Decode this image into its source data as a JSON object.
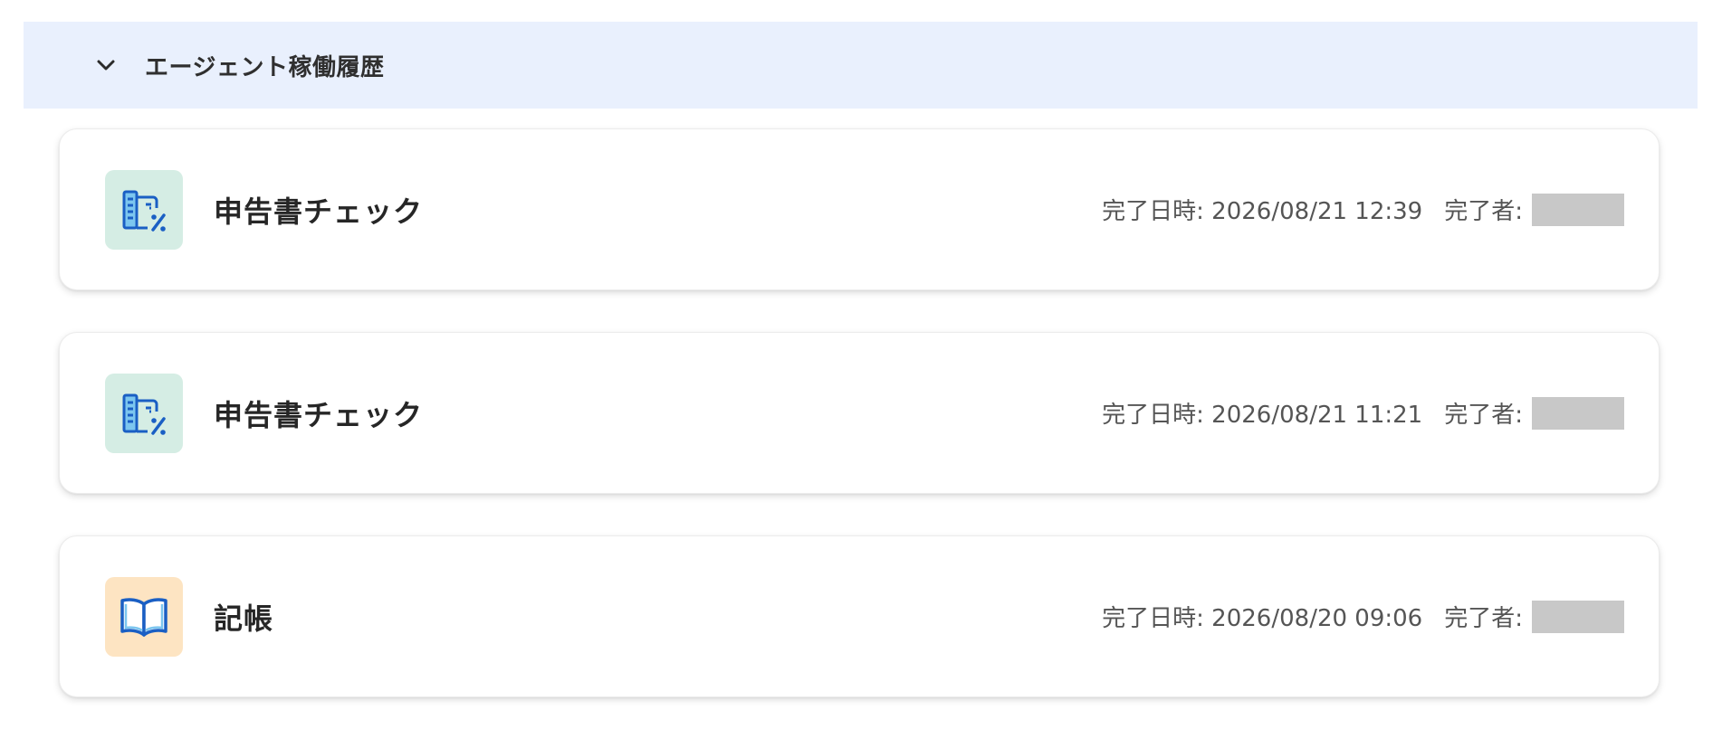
{
  "section": {
    "title": "エージェント稼働履歴",
    "expanded_icon": "chevron-down-icon"
  },
  "colors": {
    "header_bg": "#e9f0fd",
    "icon_teal_bg": "#d5ede4",
    "icon_peach_bg": "#fde4c2",
    "icon_blue": "#1a5fc4",
    "redacted": "#c8c8c8"
  },
  "history": [
    {
      "icon": "tax-document-check-icon",
      "title": "申告書チェック",
      "completed_at": "完了日時: 2026/08/21 12:39",
      "completed_by_label": "完了者:"
    },
    {
      "icon": "tax-document-check-icon",
      "title": "申告書チェック",
      "completed_at": "完了日時: 2026/08/21 11:21",
      "completed_by_label": "完了者:"
    },
    {
      "icon": "open-book-icon",
      "title": "記帳",
      "completed_at": "完了日時: 2026/08/20 09:06",
      "completed_by_label": "完了者:"
    }
  ]
}
